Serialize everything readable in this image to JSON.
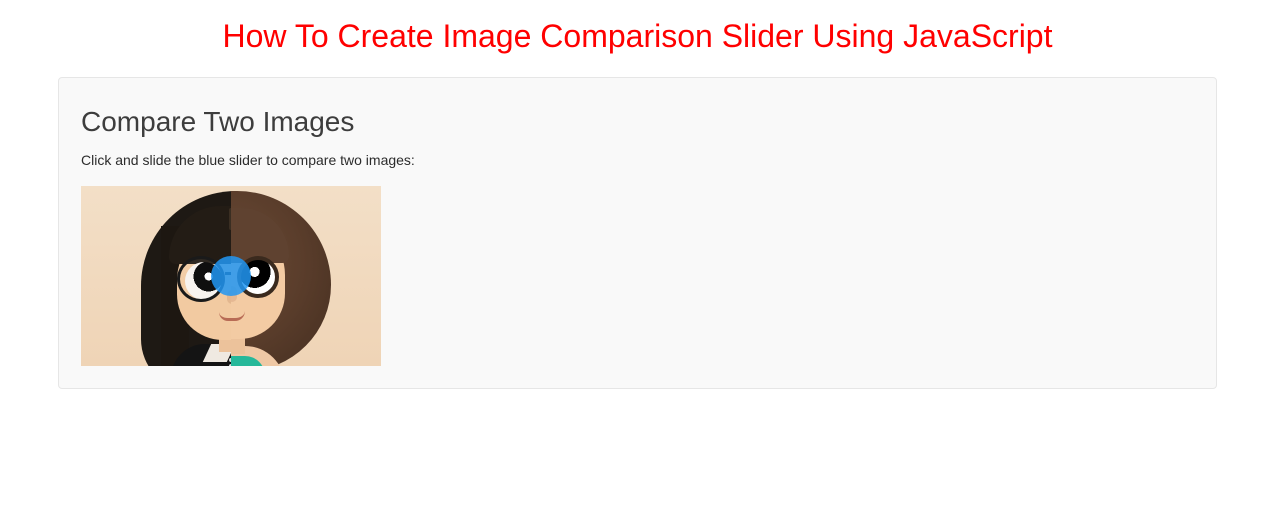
{
  "page": {
    "title": "How To Create Image Comparison Slider Using JavaScript"
  },
  "section": {
    "heading": "Compare Two Images",
    "instructions": "Click and slide the blue slider to compare two images:"
  },
  "slider": {
    "accent_color": "#2196F3",
    "position_percent": 50
  }
}
